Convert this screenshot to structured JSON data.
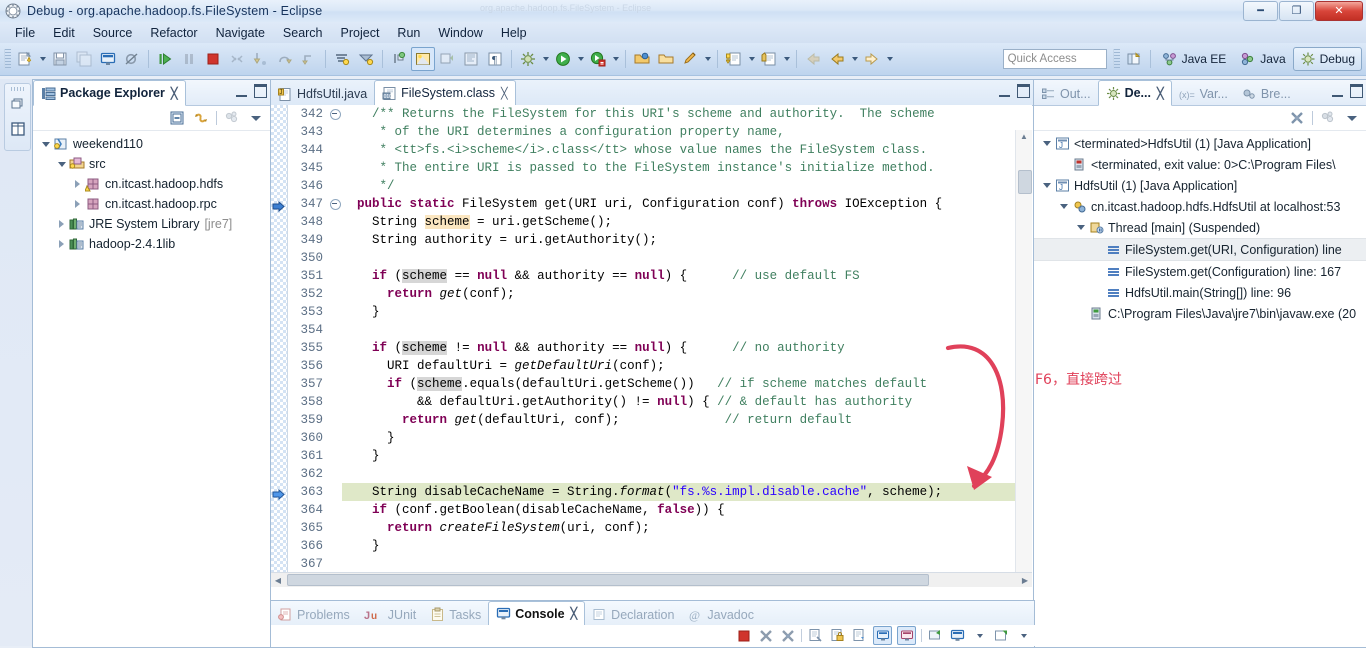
{
  "window": {
    "title": "Debug - org.apache.hadoop.fs.FileSystem - Eclipse",
    "ghost_title": "org.apache.hadoop.fs.FileSystem - Eclipse",
    "minimize_label": "—",
    "maximize_label": "❑",
    "close_label": "✕"
  },
  "menubar": {
    "items": [
      "File",
      "Edit",
      "Source",
      "Refactor",
      "Navigate",
      "Search",
      "Project",
      "Run",
      "Window",
      "Help"
    ]
  },
  "toolbar": {
    "quick_access_placeholder": "Quick Access",
    "perspectives": [
      {
        "label": "Java EE",
        "active": false
      },
      {
        "label": "Java",
        "active": false
      },
      {
        "label": "Debug",
        "active": true
      }
    ],
    "icons": [
      "new-wizard-icon",
      "new-dropdown-icon",
      "save-icon",
      "save-all-icon",
      "new-java-console-icon",
      "skip-all-breakpoints-icon",
      "resume-icon",
      "suspend-icon",
      "terminate-icon",
      "disconnect-icon",
      "step-into-icon",
      "step-over-icon",
      "step-return-icon",
      "use-step-filters-icon",
      "drop-to-frame-icon",
      "next-annotation-icon",
      "previous-annotation-icon",
      "toggle-mark-occurrences-icon",
      "toggle-block-selection-icon",
      "show-whitespace-icon",
      "debug-launch-icon",
      "run-launch-icon",
      "external-tools-icon",
      "open-type-icon",
      "open-task-icon",
      "new-java-class-icon",
      "new-package-icon",
      "search-icon",
      "back-icon",
      "forward-icon",
      "open-perspective-icon"
    ]
  },
  "fastview": {
    "icons": [
      "restore-icon",
      "package-explorer-fastview-icon"
    ]
  },
  "package_explorer": {
    "tab_label": "Package Explorer",
    "tab_icon": "package-explorer-icon",
    "tab_close": "╳",
    "toolbar_icons": [
      "collapse-all-icon",
      "link-with-editor-icon",
      "focus-on-active-task-icon",
      "view-menu-icon"
    ],
    "tree": [
      {
        "indent": 0,
        "twisty": "open",
        "icon": "java-project-icon",
        "label": "weekend110",
        "suffix": ""
      },
      {
        "indent": 1,
        "twisty": "open",
        "icon": "source-folder-icon",
        "label": "src",
        "suffix": ""
      },
      {
        "indent": 2,
        "twisty": "closed",
        "icon": "package-warn-icon",
        "label": "cn.itcast.hadoop.hdfs",
        "suffix": ""
      },
      {
        "indent": 2,
        "twisty": "closed",
        "icon": "package-icon",
        "label": "cn.itcast.hadoop.rpc",
        "suffix": ""
      },
      {
        "indent": 1,
        "twisty": "closed",
        "icon": "library-icon",
        "label": "JRE System Library",
        "suffix": "[jre7]"
      },
      {
        "indent": 1,
        "twisty": "closed",
        "icon": "library-icon",
        "label": "hadoop-2.4.1lib",
        "suffix": ""
      }
    ]
  },
  "editor": {
    "tabs": [
      {
        "label": "HdfsUtil.java",
        "icon": "java-file-icon",
        "active": false,
        "close": ""
      },
      {
        "label": "FileSystem.class",
        "icon": "class-file-icon",
        "active": true,
        "close": "╳"
      }
    ],
    "first_line_number": 342,
    "highlighted_line": 363,
    "lines": [
      {
        "n": 342,
        "fold": true,
        "tokens": [
          {
            "t": "    ",
            "c": ""
          },
          {
            "t": "/** Returns the FileSystem for this URI's scheme and authority.  The scheme",
            "c": "cmt"
          }
        ]
      },
      {
        "n": 343,
        "fold": false,
        "tokens": [
          {
            "t": "     ",
            "c": ""
          },
          {
            "t": "* of the URI determines a configuration property name,",
            "c": "cmt"
          }
        ]
      },
      {
        "n": 344,
        "fold": false,
        "tokens": [
          {
            "t": "     ",
            "c": ""
          },
          {
            "t": "* <tt>fs.<i>scheme</i>.class</tt> whose value names the FileSystem class.",
            "c": "cmt"
          }
        ]
      },
      {
        "n": 345,
        "fold": false,
        "tokens": [
          {
            "t": "     ",
            "c": ""
          },
          {
            "t": "* The entire URI is passed to the FileSystem instance's initialize method.",
            "c": "cmt"
          }
        ]
      },
      {
        "n": 346,
        "fold": false,
        "tokens": [
          {
            "t": "     ",
            "c": ""
          },
          {
            "t": "*/",
            "c": "cmt"
          }
        ]
      },
      {
        "n": 347,
        "fold": true,
        "tokens": [
          {
            "t": "  ",
            "c": ""
          },
          {
            "t": "public static",
            "c": "kw"
          },
          {
            "t": " FileSystem get(URI uri, Configuration conf) ",
            "c": ""
          },
          {
            "t": "throws",
            "c": "kw"
          },
          {
            "t": " IOException {",
            "c": ""
          }
        ]
      },
      {
        "n": 348,
        "fold": false,
        "tokens": [
          {
            "t": "    String ",
            "c": ""
          },
          {
            "t": "scheme",
            "c": "occ"
          },
          {
            "t": " = uri.getScheme();",
            "c": ""
          }
        ]
      },
      {
        "n": 349,
        "fold": false,
        "tokens": [
          {
            "t": "    String authority = uri.getAuthority();",
            "c": ""
          }
        ]
      },
      {
        "n": 350,
        "fold": false,
        "tokens": [
          {
            "t": "",
            "c": ""
          }
        ]
      },
      {
        "n": 351,
        "fold": false,
        "tokens": [
          {
            "t": "    ",
            "c": ""
          },
          {
            "t": "if",
            "c": "kw"
          },
          {
            "t": " (",
            "c": ""
          },
          {
            "t": "scheme",
            "c": "sel"
          },
          {
            "t": " == ",
            "c": ""
          },
          {
            "t": "null",
            "c": "kw"
          },
          {
            "t": " && authority == ",
            "c": ""
          },
          {
            "t": "null",
            "c": "kw"
          },
          {
            "t": ") {      ",
            "c": ""
          },
          {
            "t": "// use default FS",
            "c": "cmt"
          }
        ]
      },
      {
        "n": 352,
        "fold": false,
        "tokens": [
          {
            "t": "      ",
            "c": ""
          },
          {
            "t": "return",
            "c": "kw"
          },
          {
            "t": " ",
            "c": ""
          },
          {
            "t": "get",
            "c": "ital"
          },
          {
            "t": "(conf);",
            "c": ""
          }
        ]
      },
      {
        "n": 353,
        "fold": false,
        "tokens": [
          {
            "t": "    }",
            "c": ""
          }
        ]
      },
      {
        "n": 354,
        "fold": false,
        "tokens": [
          {
            "t": "",
            "c": ""
          }
        ]
      },
      {
        "n": 355,
        "fold": false,
        "tokens": [
          {
            "t": "    ",
            "c": ""
          },
          {
            "t": "if",
            "c": "kw"
          },
          {
            "t": " (",
            "c": ""
          },
          {
            "t": "scheme",
            "c": "sel"
          },
          {
            "t": " != ",
            "c": ""
          },
          {
            "t": "null",
            "c": "kw"
          },
          {
            "t": " && authority == ",
            "c": ""
          },
          {
            "t": "null",
            "c": "kw"
          },
          {
            "t": ") {      ",
            "c": ""
          },
          {
            "t": "// no authority",
            "c": "cmt"
          }
        ]
      },
      {
        "n": 356,
        "fold": false,
        "tokens": [
          {
            "t": "      URI defaultUri = ",
            "c": ""
          },
          {
            "t": "getDefaultUri",
            "c": "ital"
          },
          {
            "t": "(conf);",
            "c": ""
          }
        ]
      },
      {
        "n": 357,
        "fold": false,
        "tokens": [
          {
            "t": "      ",
            "c": ""
          },
          {
            "t": "if",
            "c": "kw"
          },
          {
            "t": " (",
            "c": ""
          },
          {
            "t": "scheme",
            "c": "sel"
          },
          {
            "t": ".equals(defaultUri.getScheme())   ",
            "c": ""
          },
          {
            "t": "// if scheme matches default",
            "c": "cmt"
          }
        ]
      },
      {
        "n": 358,
        "fold": false,
        "tokens": [
          {
            "t": "          && defaultUri.getAuthority() != ",
            "c": ""
          },
          {
            "t": "null",
            "c": "kw"
          },
          {
            "t": ") { ",
            "c": ""
          },
          {
            "t": "// & default has authority",
            "c": "cmt"
          }
        ]
      },
      {
        "n": 359,
        "fold": false,
        "tokens": [
          {
            "t": "        ",
            "c": ""
          },
          {
            "t": "return",
            "c": "kw"
          },
          {
            "t": " ",
            "c": ""
          },
          {
            "t": "get",
            "c": "ital"
          },
          {
            "t": "(defaultUri, conf);              ",
            "c": ""
          },
          {
            "t": "// return default",
            "c": "cmt"
          }
        ]
      },
      {
        "n": 360,
        "fold": false,
        "tokens": [
          {
            "t": "      }",
            "c": ""
          }
        ]
      },
      {
        "n": 361,
        "fold": false,
        "tokens": [
          {
            "t": "    }",
            "c": ""
          }
        ]
      },
      {
        "n": 362,
        "fold": false,
        "tokens": [
          {
            "t": "",
            "c": ""
          }
        ]
      },
      {
        "n": 363,
        "fold": false,
        "hl": true,
        "tokens": [
          {
            "t": "    String disableCacheName = String.",
            "c": ""
          },
          {
            "t": "format",
            "c": "ital"
          },
          {
            "t": "(",
            "c": ""
          },
          {
            "t": "\"fs.%s.impl.disable.cache\"",
            "c": "str"
          },
          {
            "t": ", scheme);",
            "c": ""
          }
        ]
      },
      {
        "n": 364,
        "fold": false,
        "tokens": [
          {
            "t": "    ",
            "c": ""
          },
          {
            "t": "if",
            "c": "kw"
          },
          {
            "t": " (conf.getBoolean(disableCacheName, ",
            "c": ""
          },
          {
            "t": "false",
            "c": "kw"
          },
          {
            "t": ")) {",
            "c": ""
          }
        ]
      },
      {
        "n": 365,
        "fold": false,
        "tokens": [
          {
            "t": "      ",
            "c": ""
          },
          {
            "t": "return",
            "c": "kw"
          },
          {
            "t": " ",
            "c": ""
          },
          {
            "t": "createFileSystem",
            "c": "ital"
          },
          {
            "t": "(uri, conf);",
            "c": ""
          }
        ]
      },
      {
        "n": 366,
        "fold": false,
        "tokens": [
          {
            "t": "    }",
            "c": ""
          }
        ]
      },
      {
        "n": 367,
        "fold": false,
        "tokens": [
          {
            "t": "",
            "c": ""
          }
        ]
      }
    ]
  },
  "debug_view": {
    "tabs": [
      {
        "label": "Out...",
        "icon": "outline-icon",
        "active": false,
        "close": ""
      },
      {
        "label": "De...",
        "icon": "debug-icon",
        "active": true,
        "close": "╳"
      },
      {
        "label": "Var...",
        "icon": "variables-icon",
        "active": false,
        "close": ""
      },
      {
        "label": "Bre...",
        "icon": "breakpoints-icon",
        "active": false,
        "close": ""
      }
    ],
    "toolbar_icons": [
      "remove-all-terminated-icon",
      "view-tree-icon",
      "view-menu-icon"
    ],
    "tree": [
      {
        "indent": 0,
        "twisty": "open",
        "icon": "launch-terminated-icon",
        "label": "<terminated>HdfsUtil (1) [Java Application]",
        "selected": false
      },
      {
        "indent": 1,
        "twisty": "none",
        "icon": "process-terminated-icon",
        "label": "<terminated, exit value: 0>C:\\Program Files\\",
        "selected": false
      },
      {
        "indent": 0,
        "twisty": "open",
        "icon": "launch-icon",
        "label": "HdfsUtil (1) [Java Application]",
        "selected": false
      },
      {
        "indent": 1,
        "twisty": "open",
        "icon": "debug-target-icon",
        "label": "cn.itcast.hadoop.hdfs.HdfsUtil at localhost:53",
        "selected": false
      },
      {
        "indent": 2,
        "twisty": "open",
        "icon": "thread-suspended-icon",
        "label": "Thread [main] (Suspended)",
        "selected": false
      },
      {
        "indent": 3,
        "twisty": "none",
        "icon": "stack-frame-icon",
        "label": "FileSystem.get(URI, Configuration) line",
        "selected": true
      },
      {
        "indent": 3,
        "twisty": "none",
        "icon": "stack-frame-icon",
        "label": "FileSystem.get(Configuration) line: 167",
        "selected": false
      },
      {
        "indent": 3,
        "twisty": "none",
        "icon": "stack-frame-icon",
        "label": "HdfsUtil.main(String[]) line: 96",
        "selected": false
      },
      {
        "indent": 2,
        "twisty": "none",
        "icon": "process-icon",
        "label": "C:\\Program Files\\Java\\jre7\\bin\\javaw.exe (20",
        "selected": false
      }
    ]
  },
  "console": {
    "tabs": [
      {
        "label": "Problems",
        "icon": "problems-icon",
        "active": false,
        "close": ""
      },
      {
        "label": "JUnit",
        "icon": "junit-icon",
        "active": false,
        "close": ""
      },
      {
        "label": "Tasks",
        "icon": "tasks-icon",
        "active": false,
        "close": ""
      },
      {
        "label": "Console",
        "icon": "console-icon",
        "active": true,
        "close": "╳"
      },
      {
        "label": "Declaration",
        "icon": "declaration-icon",
        "active": false,
        "close": ""
      },
      {
        "label": "Javadoc",
        "icon": "javadoc-icon",
        "active": false,
        "close": ""
      }
    ],
    "toolbar_icons": [
      "terminate-icon",
      "remove-launch-icon",
      "remove-all-terminated-icon",
      "clear-console-icon",
      "scroll-lock-icon",
      "word-wrap-icon",
      "pin-console-icon",
      "show-console-on-output-icon",
      "display-selected-console-icon",
      "open-console-icon",
      "new-console-view-icon"
    ]
  },
  "annotation": {
    "text": "F6，直接跨过",
    "color": "#e0415a",
    "shape": "curved-arrow-down-left"
  },
  "colors": {
    "accent": "#2a6db5",
    "highlight_line": "#dfe8c8",
    "keyword": "#7f0055",
    "comment": "#3f7f5f",
    "string": "#2a00ff",
    "occurrence": "#fbe6c0"
  }
}
